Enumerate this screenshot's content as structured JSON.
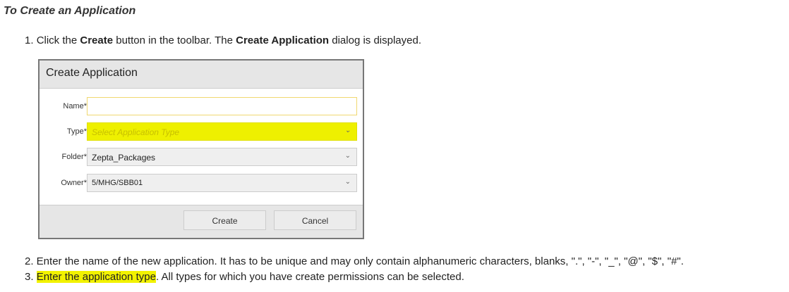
{
  "heading": "To Create an Application",
  "step1": {
    "num": "1. ",
    "a": "Click the ",
    "b": "Create",
    "c": " button in the toolbar. The ",
    "d": "Create Application",
    "e": " dialog is displayed."
  },
  "dialog": {
    "title": "Create Application",
    "fields": [
      {
        "label": "Name*",
        "value": ""
      },
      {
        "label": "Type*",
        "placeholder": "Select Application Type"
      },
      {
        "label": "Folder*",
        "value": "Zepta_Packages"
      },
      {
        "label": "Owner*",
        "value": "5/MHG/SBB01"
      }
    ],
    "create": "Create",
    "cancel": "Cancel"
  },
  "step2": "2. Enter the name of the new application. It has to be unique and may only contain alphanumeric characters, blanks, \".\", \"-\", \"_\", \"@\", \"$\", \"#\".",
  "step3": {
    "num": "3. ",
    "hl": "Enter the application type",
    "rest": ". All types for which you have create permissions can be selected."
  },
  "colors": {
    "highlight": "#f2f200"
  }
}
